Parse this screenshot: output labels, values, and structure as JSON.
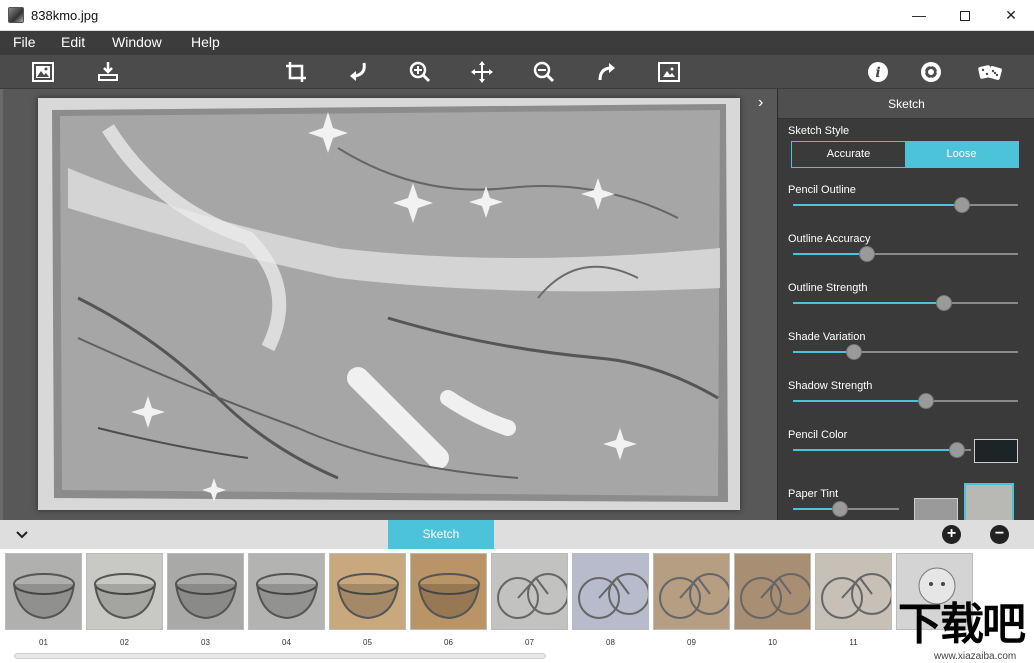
{
  "window": {
    "title": "838kmo.jpg"
  },
  "menu": [
    "File",
    "Edit",
    "Window",
    "Help"
  ],
  "toolbar": {
    "left": [
      "open-image-icon",
      "save-image-icon"
    ],
    "center": [
      "crop-icon",
      "undo-icon",
      "zoom-in-icon",
      "move-icon",
      "zoom-out-icon",
      "redo-icon",
      "fit-image-icon"
    ],
    "right": [
      "info-icon",
      "settings-icon",
      "random-dice-icon"
    ]
  },
  "panel": {
    "title": "Sketch",
    "sketch_style_label": "Sketch Style",
    "style_options": [
      "Accurate",
      "Loose"
    ],
    "selected_style": "Loose",
    "sliders": [
      {
        "label": "Pencil Outline",
        "value": 0.75
      },
      {
        "label": "Outline Accuracy",
        "value": 0.33
      },
      {
        "label": "Outline Strength",
        "value": 0.67
      },
      {
        "label": "Shade Variation",
        "value": 0.27
      },
      {
        "label": "Shadow Strength",
        "value": 0.59
      },
      {
        "label": "Pencil Color",
        "value": 0.92
      },
      {
        "label": "Paper Tint",
        "value": 0.44
      }
    ],
    "pencil_color": "#1c2428",
    "paper_tint_color": "#9a9a9a"
  },
  "bottom": {
    "tab_label": "Sketch",
    "add_label": "+",
    "remove_label": "−"
  },
  "presets": [
    "01",
    "02",
    "03",
    "04",
    "05",
    "06",
    "07",
    "08",
    "09",
    "10",
    "11",
    ""
  ],
  "watermark": {
    "glyphs": "下载吧",
    "url": "www.xiazaiba.com"
  },
  "colors": {
    "accent": "#4cc3d9"
  }
}
